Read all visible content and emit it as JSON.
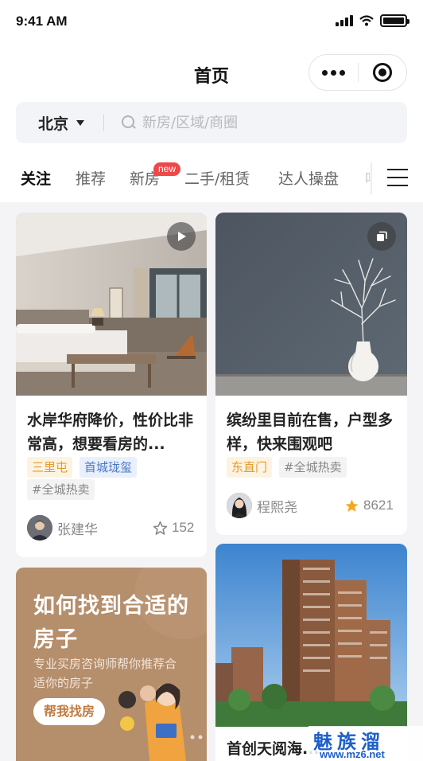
{
  "status_bar": {
    "time": "9:41 AM"
  },
  "nav": {
    "title": "首页",
    "more_icon": "more-dots-icon",
    "close_icon": "target-circle-icon"
  },
  "search": {
    "city": "北京",
    "placeholder": "新房/区域/商圈"
  },
  "tabs": [
    {
      "label": "关注",
      "active": true
    },
    {
      "label": "推荐"
    },
    {
      "label": "新房",
      "badge": "new"
    },
    {
      "label": "二手/租赁"
    },
    {
      "label": "达人操盘"
    },
    {
      "label": "喝"
    }
  ],
  "feed": {
    "card1": {
      "title": "水岸华府降价，性价比非常高，想要看房的...",
      "media": "play-icon",
      "tags": [
        "三里屯",
        "首城珑玺",
        "#全城热卖"
      ],
      "author": "张建华",
      "likes": "152",
      "liked": false
    },
    "card2": {
      "title": "缤纷里目前在售，户型多样，快来围观吧",
      "media": "gallery-icon",
      "tags": [
        "东直门",
        "#全城热卖"
      ],
      "author": "程熙尧",
      "likes": "8621",
      "liked": true
    },
    "promo": {
      "title": "如何找到合适的房子",
      "subtitle": "专业买房咨询师帮你推荐合适你的房子",
      "button": "帮我找房"
    },
    "card4": {
      "title": "首创天阅海..."
    }
  },
  "colors": {
    "accent": "#f5b33b",
    "badge": "#f04848",
    "star": "#f5a623",
    "promo_bg": "#b58e6c"
  },
  "watermark": {
    "main": "魅族溜",
    "url": "www.mz6.net"
  }
}
